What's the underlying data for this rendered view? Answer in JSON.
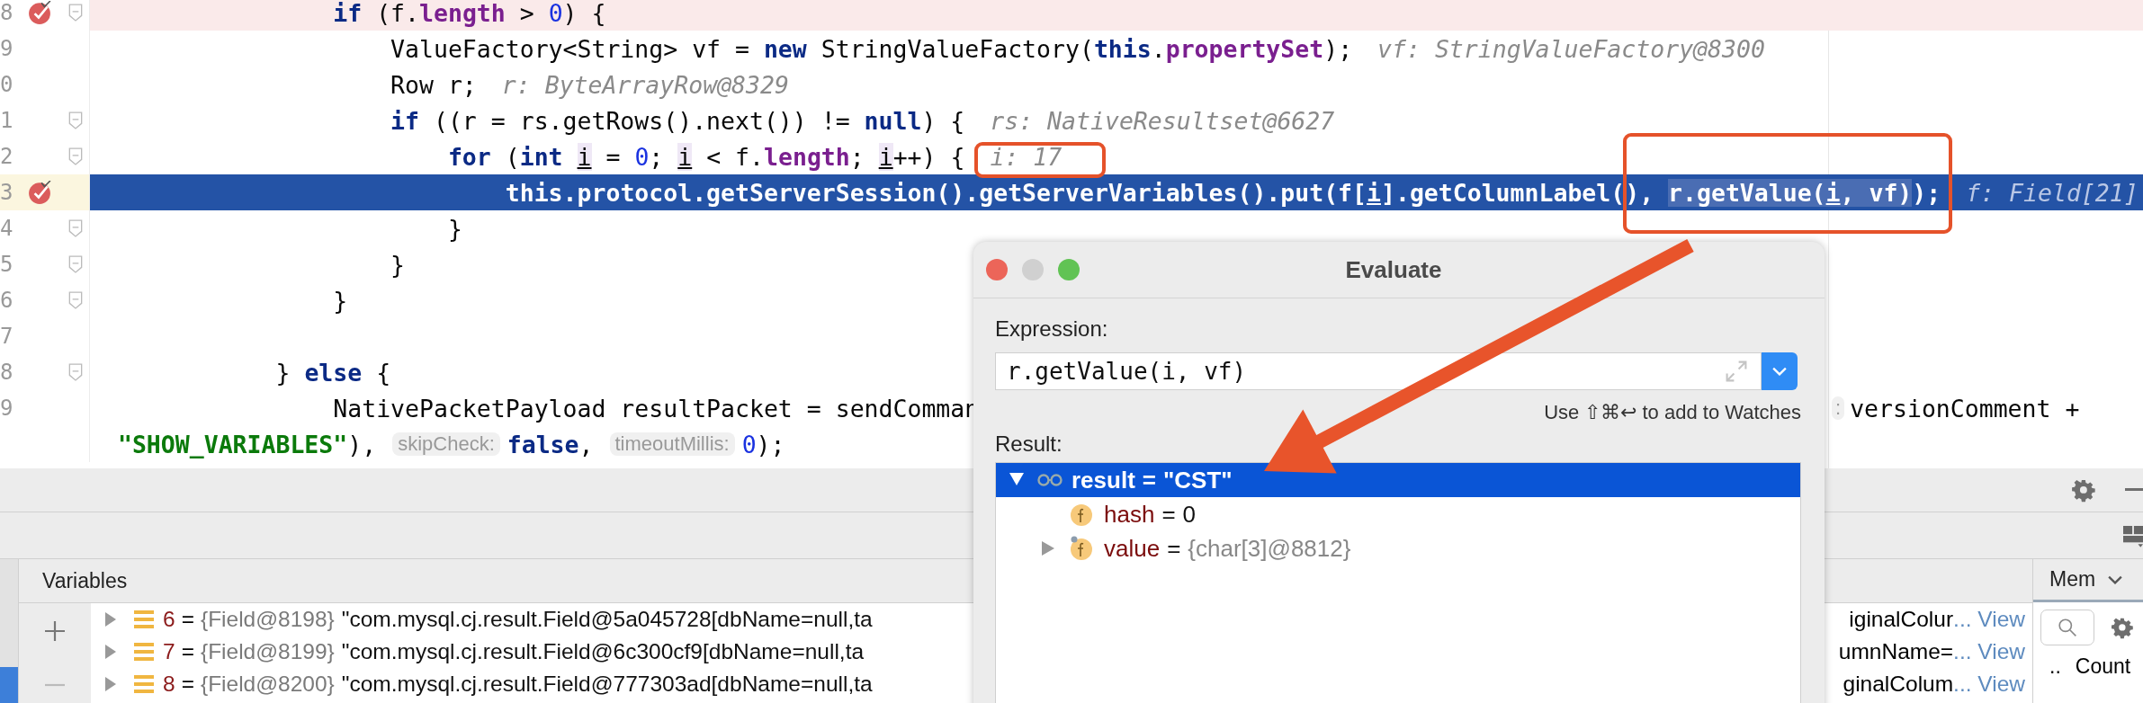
{
  "editor": {
    "lines": [
      {
        "number": "8",
        "breakpoint": true,
        "fold": true,
        "selected": false,
        "tokens": [
          {
            "kind": "keyword",
            "text": "                if"
          },
          {
            "kind": "plain",
            "text": " (f."
          },
          {
            "kind": "field",
            "text": "length"
          },
          {
            "kind": "plain",
            "text": " > "
          },
          {
            "kind": "number",
            "text": "0"
          },
          {
            "kind": "plain",
            "text": ") {"
          }
        ]
      },
      {
        "number": "9",
        "breakpoint": false,
        "fold": false,
        "selected": false,
        "tokens": [
          {
            "kind": "plain",
            "text": "                    ValueFactory<String> vf = "
          },
          {
            "kind": "keyword",
            "text": "new"
          },
          {
            "kind": "plain",
            "text": " StringValueFactory("
          },
          {
            "kind": "keyword",
            "text": "this"
          },
          {
            "kind": "plain",
            "text": "."
          },
          {
            "kind": "field",
            "text": "propertySet"
          },
          {
            "kind": "plain",
            "text": ");"
          },
          {
            "kind": "hint",
            "text": "vf: StringValueFactory@8300"
          }
        ]
      },
      {
        "number": "0",
        "breakpoint": false,
        "fold": false,
        "selected": false,
        "tokens": [
          {
            "kind": "plain",
            "text": "                    Row r;"
          },
          {
            "kind": "hint",
            "text": "r: ByteArrayRow@8329"
          }
        ]
      },
      {
        "number": "1",
        "breakpoint": false,
        "fold": true,
        "selected": false,
        "tokens": [
          {
            "kind": "keyword",
            "text": "                    if"
          },
          {
            "kind": "plain",
            "text": " ((r = rs.getRows().next()) != "
          },
          {
            "kind": "keyword",
            "text": "null"
          },
          {
            "kind": "plain",
            "text": ") {"
          },
          {
            "kind": "hint",
            "text": "rs: NativeResultset@6627"
          }
        ]
      },
      {
        "number": "2",
        "breakpoint": false,
        "fold": true,
        "selected": false,
        "tokens": [
          {
            "kind": "keyword",
            "text": "                        for"
          },
          {
            "kind": "plain",
            "text": " ("
          },
          {
            "kind": "keyword",
            "text": "int "
          },
          {
            "kind": "var",
            "text": "i"
          },
          {
            "kind": "plain",
            "text": " = "
          },
          {
            "kind": "number",
            "text": "0"
          },
          {
            "kind": "plain",
            "text": "; "
          },
          {
            "kind": "var",
            "text": "i"
          },
          {
            "kind": "plain",
            "text": " < f."
          },
          {
            "kind": "field",
            "text": "length"
          },
          {
            "kind": "plain",
            "text": "; "
          },
          {
            "kind": "var",
            "text": "i"
          },
          {
            "kind": "plain",
            "text": "++) {"
          },
          {
            "kind": "hint",
            "text": "i: 17"
          }
        ]
      },
      {
        "number": "3",
        "breakpoint": true,
        "fold": false,
        "selected": true,
        "tokens": [
          {
            "kind": "keyword",
            "text": "                            this"
          },
          {
            "kind": "plain",
            "text": "."
          },
          {
            "kind": "field",
            "text": "protocol"
          },
          {
            "kind": "plain",
            "text": ".getServerSession().getServerVariables().put(f["
          },
          {
            "kind": "var",
            "text": "i"
          },
          {
            "kind": "plain",
            "text": "].getColumnLabel(), "
          },
          {
            "kind": "selection",
            "text": "r.getValue("
          },
          {
            "kind": "selvar",
            "text": "i"
          },
          {
            "kind": "selection",
            "text": ", vf)"
          },
          {
            "kind": "plain",
            "text": ");"
          },
          {
            "kind": "hint",
            "text": "f: Field[21]"
          }
        ]
      },
      {
        "number": "4",
        "breakpoint": false,
        "fold": true,
        "selected": false,
        "tokens": [
          {
            "kind": "plain",
            "text": "                        }"
          }
        ]
      },
      {
        "number": "5",
        "breakpoint": false,
        "fold": true,
        "selected": false,
        "tokens": [
          {
            "kind": "plain",
            "text": "                    }"
          }
        ]
      },
      {
        "number": "6",
        "breakpoint": false,
        "fold": true,
        "selected": false,
        "tokens": [
          {
            "kind": "plain",
            "text": "                }"
          }
        ]
      },
      {
        "number": "7",
        "breakpoint": false,
        "fold": false,
        "selected": false
      },
      {
        "number": "8",
        "breakpoint": false,
        "fold": true,
        "selected": false,
        "tokens": [
          {
            "kind": "plain",
            "text": "            } "
          },
          {
            "kind": "keyword",
            "text": "else"
          },
          {
            "kind": "plain",
            "text": " {"
          }
        ]
      },
      {
        "number": "9",
        "breakpoint": false,
        "fold": false,
        "selected": false,
        "tokens": [
          {
            "kind": "plain",
            "text": "                NativePacketPayload resultPacket = sendComman"
          }
        ],
        "tail": [
          {
            "kind": "param",
            "text": ":"
          },
          {
            "kind": "plain",
            "text": "versionComment +"
          }
        ]
      },
      {
        "breakpoint": false,
        "fold": false,
        "selected": false,
        "tokens": [
          {
            "kind": "string",
            "text": " \"SHOW_VARIABLES\""
          },
          {
            "kind": "plain",
            "text": "),"
          },
          {
            "kind": "param",
            "text": "skipCheck:"
          },
          {
            "kind": "keyword",
            "text": "false"
          },
          {
            "kind": "plain",
            "text": ","
          },
          {
            "kind": "param",
            "text": "timeoutMillis:"
          },
          {
            "kind": "number",
            "text": "0"
          },
          {
            "kind": "plain",
            "text": ");"
          }
        ]
      }
    ]
  },
  "variables": {
    "title": "Variables",
    "rows": [
      {
        "index": "6",
        "equals": "=",
        "type": "{Field@8198}",
        "value": "\"com.mysql.cj.result.Field@5a045728[dbName=null,ta",
        "tail": "iginalColur",
        "link": "... View",
        "expanded": false
      },
      {
        "index": "7",
        "equals": "=",
        "type": "{Field@8199}",
        "value": "\"com.mysql.cj.result.Field@6c300cf9[dbName=null,ta",
        "tail": "umnName=",
        "link": "... View",
        "expanded": false
      },
      {
        "index": "8",
        "equals": "=",
        "type": "{Field@8200}",
        "value": "\"com.mysql.cj.result.Field@777303ad[dbName=null,ta",
        "tail": "ginalColum",
        "link": "... View",
        "expanded": false
      }
    ]
  },
  "memory": {
    "tab": "Mem",
    "columns": [
      "..",
      "Count"
    ]
  },
  "evaluate": {
    "title": "Evaluate",
    "expression_label": "Expression:",
    "expression": "r.getValue(i, vf)",
    "hint": "Use ⇧⌘↩ to add to Watches",
    "result_label": "Result:",
    "result": [
      {
        "kind": "watch",
        "name": "result",
        "equals": "=",
        "value": "\"CST\"",
        "selected": true,
        "expanded": true,
        "children": [
          {
            "kind": "field",
            "name": "hash",
            "equals": "=",
            "value": "0",
            "selected": false
          },
          {
            "kind": "field",
            "name": "value",
            "equals": "=",
            "value": "{char[3]@8812}",
            "selected": false,
            "expanded": false
          }
        ]
      }
    ]
  }
}
